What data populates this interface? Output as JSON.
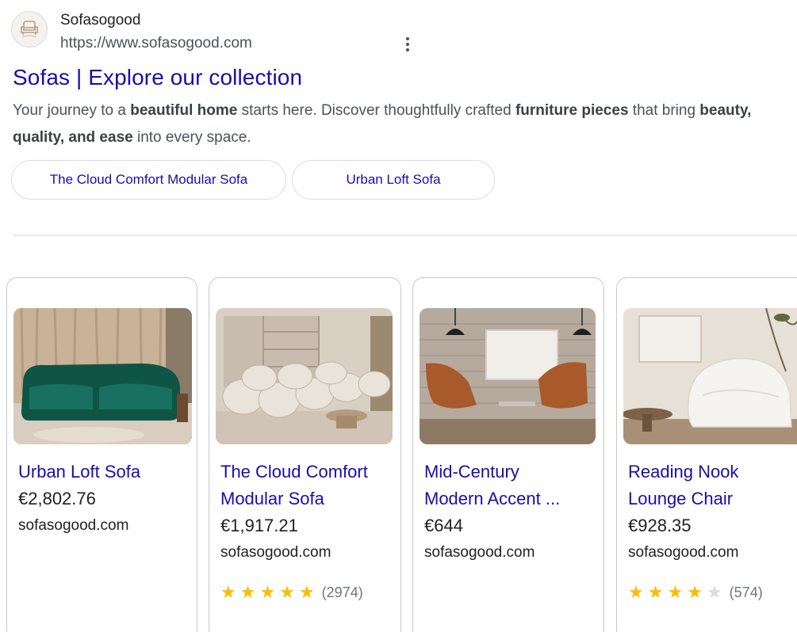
{
  "site": {
    "name": "Sofasogood",
    "url": "https://www.sofasogood.com"
  },
  "result": {
    "title": "Sofas | Explore our collection",
    "snippet": {
      "p1": "Your journey to a ",
      "b1": "beautiful home",
      "p2": " starts here. Discover thoughtfully crafted ",
      "b2": "furniture pieces",
      "p3": " that bring ",
      "b3": "beauty, quality, and ease",
      "p4": " into every space."
    }
  },
  "sitelinks": [
    {
      "label": "The Cloud Comfort Modular Sofa"
    },
    {
      "label": "Urban Loft Sofa"
    }
  ],
  "products": [
    {
      "title_line1": "Urban Loft Sofa",
      "title_line2": "",
      "price": "€2,802.76",
      "site": "sofasogood.com",
      "rating": null,
      "review_count": ""
    },
    {
      "title_line1": "The Cloud Comfort",
      "title_line2": "Modular Sofa",
      "price": "€1,917.21",
      "site": "sofasogood.com",
      "rating": 5,
      "review_count": "(2974)"
    },
    {
      "title_line1": "Mid-Century",
      "title_line2": "Modern Accent ...",
      "price": "€644",
      "site": "sofasogood.com",
      "rating": null,
      "review_count": ""
    },
    {
      "title_line1": "Reading Nook",
      "title_line2": "Lounge Chair",
      "price": "€928.35",
      "site": "sofasogood.com",
      "rating": 4,
      "review_count": "(574)"
    }
  ],
  "icons": {
    "favicon": "sofa-logo-icon",
    "menu": "more-vert-icon",
    "star": "star-icon"
  },
  "colors": {
    "link": "#1a0dab",
    "star": "#fbbc04",
    "text": "#202124"
  }
}
